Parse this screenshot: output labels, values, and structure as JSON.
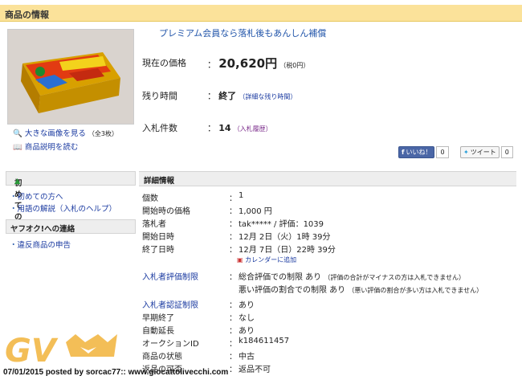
{
  "header": {
    "title": "商品の情報"
  },
  "image": {
    "enlarge_label": "大きな画像を見る",
    "enlarge_count": "（全3枚）",
    "desc_label": "商品説明を読む"
  },
  "premium": "プレミアム会員なら落札後もあんしん補償",
  "summary": {
    "price_label": "現在の価格",
    "price_value": "20,620円",
    "price_tax": "（税0円）",
    "time_label": "残り時間",
    "time_value": "終了",
    "time_link": "（詳細な残り時間）",
    "bids_label": "入札件数",
    "bids_value": "14",
    "bids_link": "（入札履歴）"
  },
  "social": {
    "like_label": "いいね！",
    "like_count": "0",
    "tweet_label": "ツイート",
    "tweet_count": "0"
  },
  "sidebar": {
    "beginner_title": "初めての方",
    "beginner_items": [
      "初めての方へ",
      "用語の解説（入札のヘルプ）"
    ],
    "contact_title": "ヤフオク!への連絡",
    "contact_items": [
      "違反商品の申告"
    ]
  },
  "details": {
    "title": "詳細情報",
    "colon": "：",
    "rows": [
      {
        "key": "個数",
        "value": "1"
      },
      {
        "key": "開始時の価格",
        "value": "1,000 円"
      },
      {
        "key": "落札者",
        "value": "tak***** / 評価：1039"
      },
      {
        "key": "開始日時",
        "value": "12月 2日（火）1時 39分"
      },
      {
        "key": "終了日時",
        "value": "12月 7日（日）22時 39分"
      }
    ],
    "calendar_label": "カレンダーに追加",
    "limit_label": "入札者評価制限",
    "limit_line1": "総合評価での制限 あり",
    "limit_note1": "（評価の合計がマイナスの方は入札できません）",
    "limit_line2": "悪い評価の割合での制限 あり",
    "limit_note2": "（悪い評価の割合が多い方は入札できません）",
    "auth_label": "入札者認証制限",
    "auth_value": "あり",
    "rows2": [
      {
        "key": "早期終了",
        "value": "なし"
      },
      {
        "key": "自動延長",
        "value": "あり"
      },
      {
        "key": "オークションID",
        "value": "k184611457"
      },
      {
        "key": "商品の状態",
        "value": "中古"
      },
      {
        "key": "返品の可否",
        "value": "返品不可"
      }
    ]
  },
  "watermark": {
    "logo": "GV",
    "footer": "07/01/2015 posted by sorcac77:: www.giocattolivecchi.com"
  }
}
